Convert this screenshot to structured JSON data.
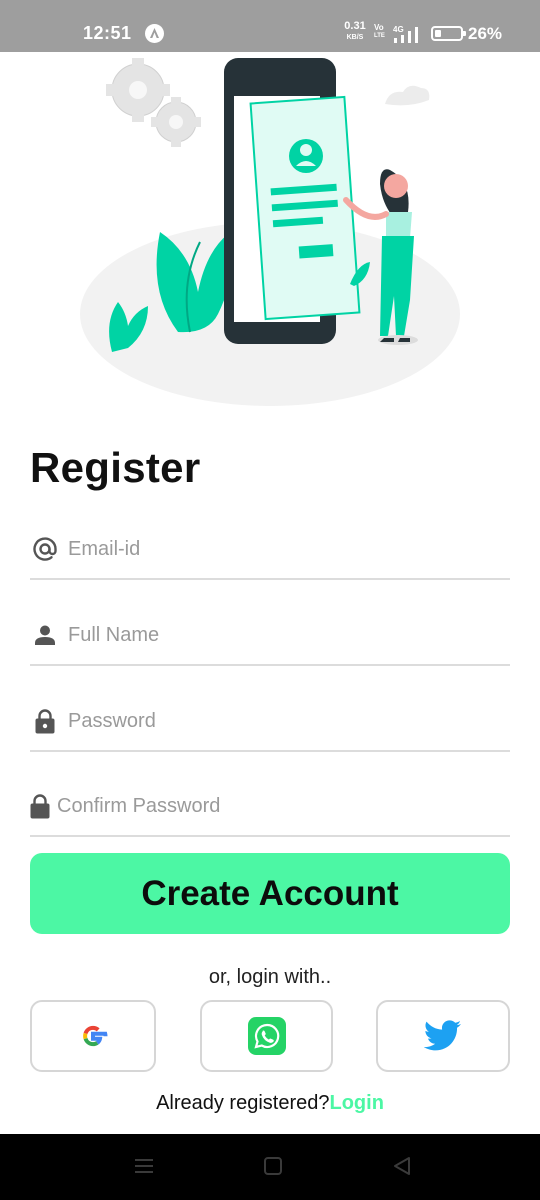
{
  "status_bar": {
    "time": "12:51",
    "net_speed_value": "0.31",
    "net_speed_unit": "KB/S",
    "volte_top": "Vo",
    "volte_bottom": "LTE",
    "network": "4G",
    "battery_level": 0.26,
    "battery_percent": "26%"
  },
  "illustration": {
    "subject": "person-with-phone-registration-illustration",
    "accent_color": "#00d3a4"
  },
  "form": {
    "title": "Register",
    "fields": [
      {
        "placeholder": "Email-id",
        "value": "",
        "icon": "at-icon"
      },
      {
        "placeholder": "Full Name",
        "value": "",
        "icon": "person-icon"
      },
      {
        "placeholder": "Password",
        "value": "",
        "icon": "lock-icon"
      },
      {
        "placeholder": "Confirm Password",
        "value": "",
        "icon": "lock-icon"
      }
    ],
    "submit_label": "Create Account"
  },
  "social": {
    "label": "or, login with..",
    "providers": [
      {
        "name": "Google",
        "icon": "google-icon"
      },
      {
        "name": "WhatsApp",
        "icon": "whatsapp-icon"
      },
      {
        "name": "Twitter",
        "icon": "twitter-icon"
      }
    ]
  },
  "footer": {
    "prompt": "Already registered?",
    "link": "Login"
  },
  "colors": {
    "accent": "#4cf7a4",
    "status_bar": "#9e9e9e",
    "twitter": "#1da1f2",
    "whatsapp": "#25d366",
    "nav_bar": "#000000"
  }
}
